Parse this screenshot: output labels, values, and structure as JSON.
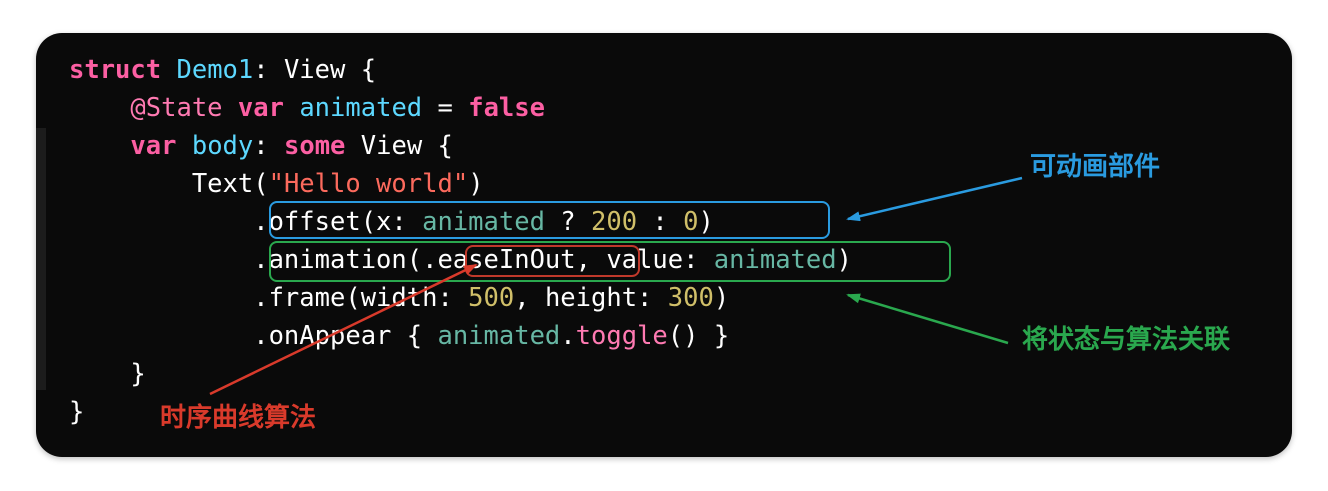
{
  "code_lines": [
    [
      {
        "text": "struct",
        "cls": "k"
      },
      {
        "text": " "
      },
      {
        "text": "Demo1",
        "cls": "t"
      },
      {
        "text": ": View {"
      }
    ],
    [
      {
        "text": "    "
      },
      {
        "text": "@State",
        "cls": "m"
      },
      {
        "text": " "
      },
      {
        "text": "var",
        "cls": "k"
      },
      {
        "text": " "
      },
      {
        "text": "animated",
        "cls": "t"
      },
      {
        "text": " = "
      },
      {
        "text": "false",
        "cls": "k"
      }
    ],
    [
      {
        "text": "    "
      },
      {
        "text": "var",
        "cls": "k"
      },
      {
        "text": " "
      },
      {
        "text": "body",
        "cls": "t"
      },
      {
        "text": ": "
      },
      {
        "text": "some",
        "cls": "k"
      },
      {
        "text": " View {"
      }
    ],
    [
      {
        "text": "        Text("
      },
      {
        "text": "\"Hello world\"",
        "cls": "s"
      },
      {
        "text": ")"
      }
    ],
    [
      {
        "text": "            .offset(x: "
      },
      {
        "text": "animated",
        "cls": "v"
      },
      {
        "text": " ? "
      },
      {
        "text": "200",
        "cls": "n"
      },
      {
        "text": " : "
      },
      {
        "text": "0",
        "cls": "n"
      },
      {
        "text": ")"
      }
    ],
    [
      {
        "text": "            .animation(.easeInOut, value: "
      },
      {
        "text": "animated",
        "cls": "v"
      },
      {
        "text": ")"
      }
    ],
    [
      {
        "text": "            .frame(width: "
      },
      {
        "text": "500",
        "cls": "n"
      },
      {
        "text": ", height: "
      },
      {
        "text": "300",
        "cls": "n"
      },
      {
        "text": ")"
      }
    ],
    [
      {
        "text": "            .onAppear { "
      },
      {
        "text": "animated",
        "cls": "v"
      },
      {
        "text": "."
      },
      {
        "text": "toggle",
        "cls": "m"
      },
      {
        "text": "() }"
      }
    ],
    [
      {
        "text": "    }"
      }
    ],
    [
      {
        "text": "}"
      }
    ]
  ],
  "annotations": {
    "blue_label": "可动画部件",
    "green_label": "将状态与算法关联",
    "red_label": "时序曲线算法"
  },
  "colors": {
    "background": "#0a0a0a",
    "keyword": "#fc5fa3",
    "type": "#5dd8ff",
    "variable": "#67b7a4",
    "string": "#fc6a5d",
    "number": "#d0bf69",
    "annotation_blue": "#2a9be0",
    "annotation_green": "#2aa84e",
    "annotation_red": "#c0392b"
  }
}
